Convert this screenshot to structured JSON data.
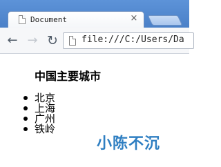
{
  "browser": {
    "tab": {
      "title": "Document",
      "icon": "document-icon",
      "close_label": "×"
    },
    "address_bar": {
      "url": "file:///C:/Users/Da"
    },
    "nav": {
      "back_icon": "back-arrow-icon",
      "forward_icon": "forward-arrow-icon",
      "reload_icon": "reload-icon"
    }
  },
  "page": {
    "heading": "中国主要城市",
    "cities": [
      "北京",
      "上海",
      "广州",
      "铁岭"
    ],
    "watermark": "小陈不沉"
  },
  "colors": {
    "tabstrip": "#4a80c8",
    "watermark": "#2f7fc2"
  }
}
